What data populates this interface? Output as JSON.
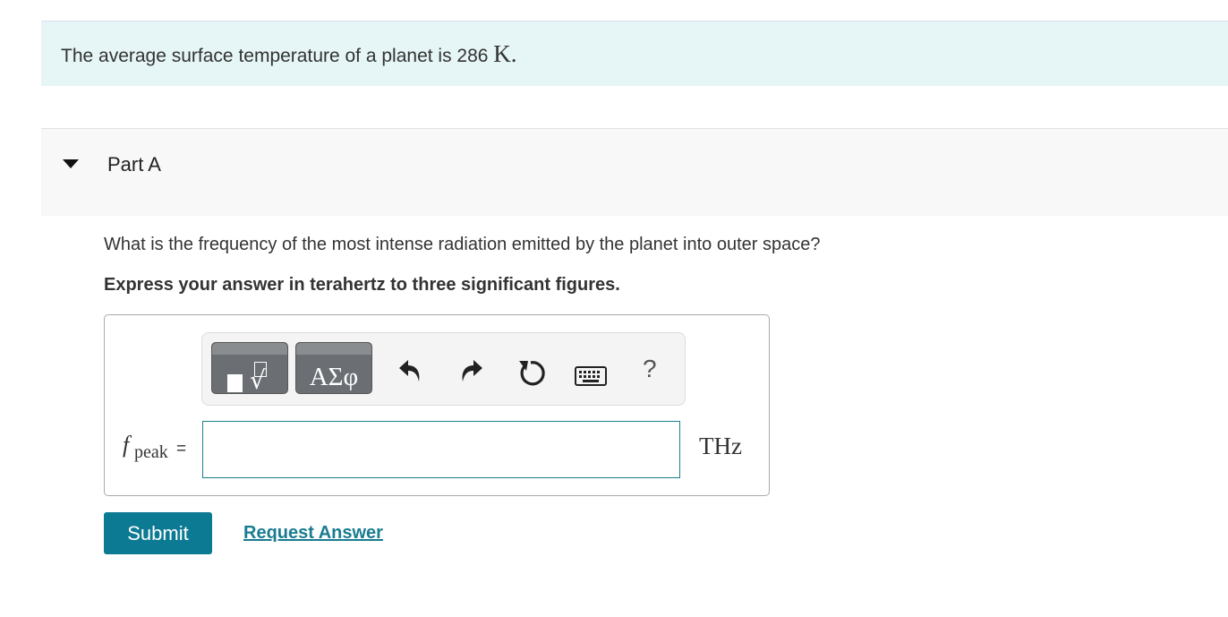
{
  "intro": {
    "text": "The average surface temperature of a planet is 286",
    "unit": "K",
    "period": "."
  },
  "part": {
    "title": "Part A",
    "caret_icon": "caret-down-icon"
  },
  "question": "What is the frequency of the most intense radiation emitted by the planet into outer space?",
  "instruction": "Express your answer in terahertz to three significant figures.",
  "toolbar": {
    "math_icon": "templates-radical-icon",
    "greek_label": "ΑΣφ",
    "undo_icon": "undo-icon",
    "redo_icon": "redo-icon",
    "reset_icon": "reset-icon",
    "keyboard_icon": "keyboard-icon",
    "help_label": "?"
  },
  "answer": {
    "variable": "f",
    "subscript": "peak",
    "equals": "=",
    "value": "",
    "unit": "THz"
  },
  "actions": {
    "submit_label": "Submit",
    "request_label": "Request Answer"
  },
  "colors": {
    "intro_bg": "#e6f5f5",
    "accent": "#0d7a93",
    "link": "#1a7c90"
  }
}
